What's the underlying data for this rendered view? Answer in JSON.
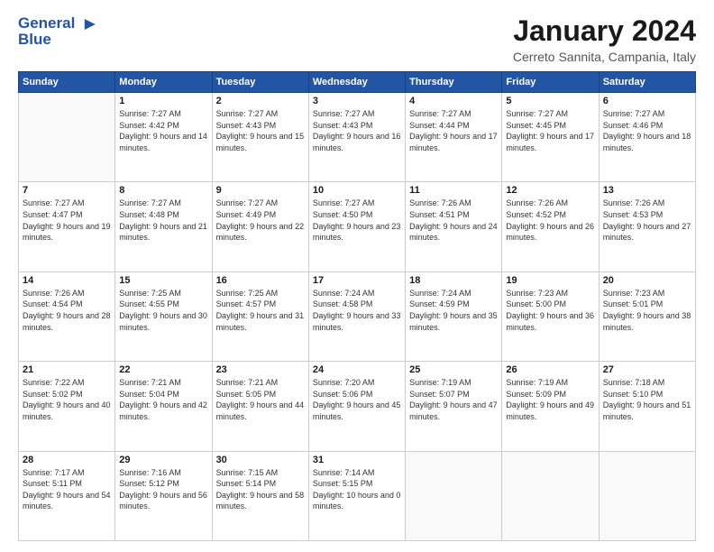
{
  "header": {
    "logo_line1": "General",
    "logo_line2": "Blue",
    "month_year": "January 2024",
    "location": "Cerreto Sannita, Campania, Italy"
  },
  "days_of_week": [
    "Sunday",
    "Monday",
    "Tuesday",
    "Wednesday",
    "Thursday",
    "Friday",
    "Saturday"
  ],
  "weeks": [
    [
      {
        "day": "",
        "sunrise": "",
        "sunset": "",
        "daylight": ""
      },
      {
        "day": "1",
        "sunrise": "Sunrise: 7:27 AM",
        "sunset": "Sunset: 4:42 PM",
        "daylight": "Daylight: 9 hours and 14 minutes."
      },
      {
        "day": "2",
        "sunrise": "Sunrise: 7:27 AM",
        "sunset": "Sunset: 4:43 PM",
        "daylight": "Daylight: 9 hours and 15 minutes."
      },
      {
        "day": "3",
        "sunrise": "Sunrise: 7:27 AM",
        "sunset": "Sunset: 4:43 PM",
        "daylight": "Daylight: 9 hours and 16 minutes."
      },
      {
        "day": "4",
        "sunrise": "Sunrise: 7:27 AM",
        "sunset": "Sunset: 4:44 PM",
        "daylight": "Daylight: 9 hours and 17 minutes."
      },
      {
        "day": "5",
        "sunrise": "Sunrise: 7:27 AM",
        "sunset": "Sunset: 4:45 PM",
        "daylight": "Daylight: 9 hours and 17 minutes."
      },
      {
        "day": "6",
        "sunrise": "Sunrise: 7:27 AM",
        "sunset": "Sunset: 4:46 PM",
        "daylight": "Daylight: 9 hours and 18 minutes."
      }
    ],
    [
      {
        "day": "7",
        "sunrise": "Sunrise: 7:27 AM",
        "sunset": "Sunset: 4:47 PM",
        "daylight": "Daylight: 9 hours and 19 minutes."
      },
      {
        "day": "8",
        "sunrise": "Sunrise: 7:27 AM",
        "sunset": "Sunset: 4:48 PM",
        "daylight": "Daylight: 9 hours and 21 minutes."
      },
      {
        "day": "9",
        "sunrise": "Sunrise: 7:27 AM",
        "sunset": "Sunset: 4:49 PM",
        "daylight": "Daylight: 9 hours and 22 minutes."
      },
      {
        "day": "10",
        "sunrise": "Sunrise: 7:27 AM",
        "sunset": "Sunset: 4:50 PM",
        "daylight": "Daylight: 9 hours and 23 minutes."
      },
      {
        "day": "11",
        "sunrise": "Sunrise: 7:26 AM",
        "sunset": "Sunset: 4:51 PM",
        "daylight": "Daylight: 9 hours and 24 minutes."
      },
      {
        "day": "12",
        "sunrise": "Sunrise: 7:26 AM",
        "sunset": "Sunset: 4:52 PM",
        "daylight": "Daylight: 9 hours and 26 minutes."
      },
      {
        "day": "13",
        "sunrise": "Sunrise: 7:26 AM",
        "sunset": "Sunset: 4:53 PM",
        "daylight": "Daylight: 9 hours and 27 minutes."
      }
    ],
    [
      {
        "day": "14",
        "sunrise": "Sunrise: 7:26 AM",
        "sunset": "Sunset: 4:54 PM",
        "daylight": "Daylight: 9 hours and 28 minutes."
      },
      {
        "day": "15",
        "sunrise": "Sunrise: 7:25 AM",
        "sunset": "Sunset: 4:55 PM",
        "daylight": "Daylight: 9 hours and 30 minutes."
      },
      {
        "day": "16",
        "sunrise": "Sunrise: 7:25 AM",
        "sunset": "Sunset: 4:57 PM",
        "daylight": "Daylight: 9 hours and 31 minutes."
      },
      {
        "day": "17",
        "sunrise": "Sunrise: 7:24 AM",
        "sunset": "Sunset: 4:58 PM",
        "daylight": "Daylight: 9 hours and 33 minutes."
      },
      {
        "day": "18",
        "sunrise": "Sunrise: 7:24 AM",
        "sunset": "Sunset: 4:59 PM",
        "daylight": "Daylight: 9 hours and 35 minutes."
      },
      {
        "day": "19",
        "sunrise": "Sunrise: 7:23 AM",
        "sunset": "Sunset: 5:00 PM",
        "daylight": "Daylight: 9 hours and 36 minutes."
      },
      {
        "day": "20",
        "sunrise": "Sunrise: 7:23 AM",
        "sunset": "Sunset: 5:01 PM",
        "daylight": "Daylight: 9 hours and 38 minutes."
      }
    ],
    [
      {
        "day": "21",
        "sunrise": "Sunrise: 7:22 AM",
        "sunset": "Sunset: 5:02 PM",
        "daylight": "Daylight: 9 hours and 40 minutes."
      },
      {
        "day": "22",
        "sunrise": "Sunrise: 7:21 AM",
        "sunset": "Sunset: 5:04 PM",
        "daylight": "Daylight: 9 hours and 42 minutes."
      },
      {
        "day": "23",
        "sunrise": "Sunrise: 7:21 AM",
        "sunset": "Sunset: 5:05 PM",
        "daylight": "Daylight: 9 hours and 44 minutes."
      },
      {
        "day": "24",
        "sunrise": "Sunrise: 7:20 AM",
        "sunset": "Sunset: 5:06 PM",
        "daylight": "Daylight: 9 hours and 45 minutes."
      },
      {
        "day": "25",
        "sunrise": "Sunrise: 7:19 AM",
        "sunset": "Sunset: 5:07 PM",
        "daylight": "Daylight: 9 hours and 47 minutes."
      },
      {
        "day": "26",
        "sunrise": "Sunrise: 7:19 AM",
        "sunset": "Sunset: 5:09 PM",
        "daylight": "Daylight: 9 hours and 49 minutes."
      },
      {
        "day": "27",
        "sunrise": "Sunrise: 7:18 AM",
        "sunset": "Sunset: 5:10 PM",
        "daylight": "Daylight: 9 hours and 51 minutes."
      }
    ],
    [
      {
        "day": "28",
        "sunrise": "Sunrise: 7:17 AM",
        "sunset": "Sunset: 5:11 PM",
        "daylight": "Daylight: 9 hours and 54 minutes."
      },
      {
        "day": "29",
        "sunrise": "Sunrise: 7:16 AM",
        "sunset": "Sunset: 5:12 PM",
        "daylight": "Daylight: 9 hours and 56 minutes."
      },
      {
        "day": "30",
        "sunrise": "Sunrise: 7:15 AM",
        "sunset": "Sunset: 5:14 PM",
        "daylight": "Daylight: 9 hours and 58 minutes."
      },
      {
        "day": "31",
        "sunrise": "Sunrise: 7:14 AM",
        "sunset": "Sunset: 5:15 PM",
        "daylight": "Daylight: 10 hours and 0 minutes."
      },
      {
        "day": "",
        "sunrise": "",
        "sunset": "",
        "daylight": ""
      },
      {
        "day": "",
        "sunrise": "",
        "sunset": "",
        "daylight": ""
      },
      {
        "day": "",
        "sunrise": "",
        "sunset": "",
        "daylight": ""
      }
    ]
  ]
}
